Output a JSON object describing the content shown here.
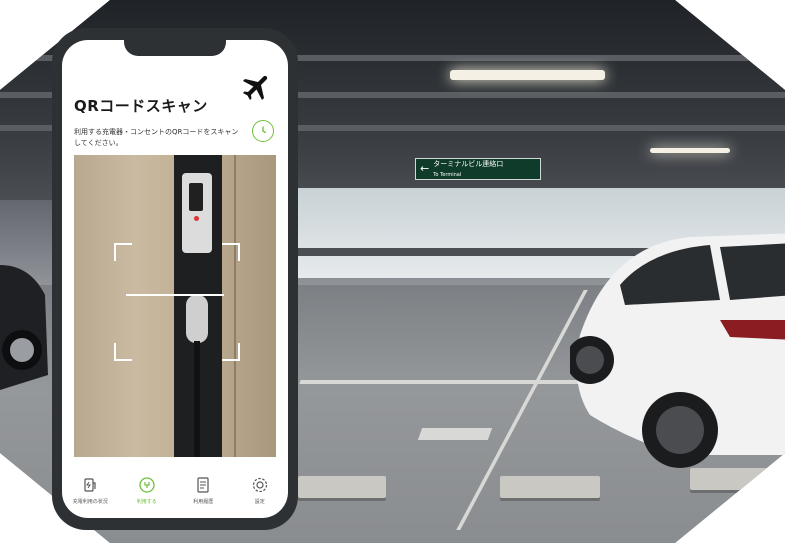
{
  "screen": {
    "title": "QRコードスキャン",
    "description": "利用する充電器・コンセントのQRコードをスキャンしてください。"
  },
  "tabs": [
    {
      "label": "充電利用の状況",
      "icon": "charging-station-icon",
      "active": false
    },
    {
      "label": "利用する",
      "icon": "plug-leaf-icon",
      "active": true
    },
    {
      "label": "利用履歴",
      "icon": "receipt-icon",
      "active": false
    },
    {
      "label": "設定",
      "icon": "gear-icon",
      "active": false
    }
  ],
  "background": {
    "sign_text": "ターミナルビル連絡口",
    "sign_subtext": "To Terminal"
  },
  "colors": {
    "accent": "#6fbf3a",
    "phone_frame": "#2e3134",
    "sign": "#0f3b2b"
  }
}
